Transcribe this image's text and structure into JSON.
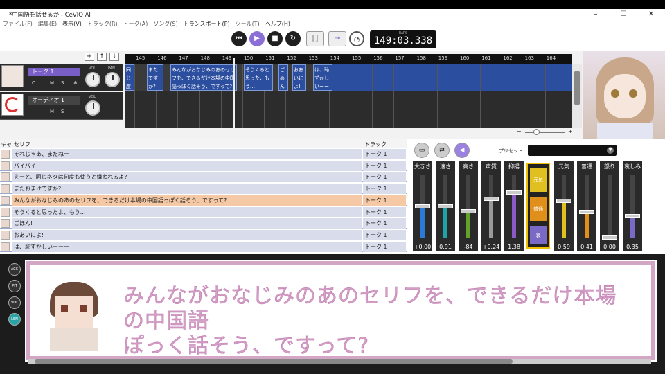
{
  "window": {
    "title": "*中国語を話せるか - CeVIO AI",
    "minimize": "–",
    "maximize": "☐",
    "close": "✕"
  },
  "menu": [
    "ファイル(F)",
    "編集(E)",
    "表示(V)",
    "トラック(R)",
    "トーク(A)",
    "ソング(S)",
    "トランスポート(P)",
    "ツール(T)",
    "ヘルプ(H)"
  ],
  "transport": {
    "time": "149:03.338",
    "time_caption": "BARS",
    "tempo_icon": "gauge-icon"
  },
  "tracks": [
    {
      "name": "トーク 1",
      "buttons": [
        "C",
        "M",
        "S",
        "❄"
      ],
      "knob1": "VOL",
      "knob2": "PAN"
    },
    {
      "name": "オーディオ 1",
      "buttons": [
        "M",
        "S"
      ],
      "knob1": "VOL"
    }
  ],
  "ruler": [
    "145",
    "146",
    "147",
    "148",
    "149",
    "150",
    "151",
    "152",
    "153",
    "154",
    "155",
    "156",
    "157",
    "158",
    "159",
    "160",
    "161",
    "162",
    "163",
    "164"
  ],
  "notes": [
    {
      "text": "同じ 度も 嫌わ"
    },
    {
      "text": "また ですか?"
    },
    {
      "text": "みんながおなじみのあのセリフを、できるだけ本場の中国語っぽく話そう、ですって?"
    },
    {
      "text": "そうくると思った、もう…"
    },
    {
      "text": "ごめん"
    },
    {
      "text": "おあいによ!"
    },
    {
      "text": "は、恥ずかしいーーー"
    }
  ],
  "list": {
    "headers": {
      "cast": "キャ",
      "line": "セリフ",
      "track": "トラック"
    },
    "rows": [
      {
        "line": "それじゃあ、またねー",
        "track": "トーク 1"
      },
      {
        "line": "バイバイ",
        "track": "トーク 1"
      },
      {
        "line": "えーと、同じネタは何度も使うと嫌われるよ?",
        "track": "トーク 1"
      },
      {
        "line": "またおまけですか?",
        "track": "トーク 1"
      },
      {
        "line": "みんながおなじみのあのセリフを、できるだけ本場の中国語っぽく話そう、ですって?",
        "track": "トーク 1",
        "selected": true
      },
      {
        "line": "そうくると思ったよ、もう…",
        "track": "トーク 1"
      },
      {
        "line": "ごほん!",
        "track": "トーク 1"
      },
      {
        "line": "おあいによ!",
        "track": "トーク 1"
      },
      {
        "line": "は、恥ずかしいーーー",
        "track": "トーク 1"
      }
    ]
  },
  "emotion": {
    "preset_label": "プリセット",
    "params": [
      {
        "label": "大きさ",
        "value": "+0.00",
        "color": "#2a7ad6",
        "level": 0.5
      },
      {
        "label": "速さ",
        "value": "0.91",
        "color": "#1ea3a6",
        "level": 0.5
      },
      {
        "label": "高さ",
        "value": "-84",
        "color": "#63a32a",
        "level": 0.42
      },
      {
        "label": "声質",
        "value": "+0.24",
        "color": "#9a9a9a",
        "level": 0.62
      },
      {
        "label": "抑揚",
        "value": "1.38",
        "color": "#8a5ac6",
        "level": 0.72
      }
    ],
    "emo_tabs": [
      "元気",
      "普通",
      "哀"
    ],
    "emo_params": [
      {
        "label": "元気",
        "value": "0.59",
        "color": "#e0c020",
        "level": 0.59
      },
      {
        "label": "普通",
        "value": "0.41",
        "color": "#e0901a",
        "level": 0.41
      },
      {
        "label": "怒り",
        "value": "0.00",
        "color": "#b44a3a",
        "level": 0.0
      },
      {
        "label": "哀しみ",
        "value": "0.35",
        "color": "#7a6ac6",
        "level": 0.35
      }
    ]
  },
  "side_buttons": [
    "ACC",
    "PIT",
    "VOL",
    "LEN"
  ],
  "subtitle": {
    "line1": "みんながおなじみのあのセリフを、できるだけ本場の中国語",
    "line2": "ぽっく話そう、ですって?"
  }
}
